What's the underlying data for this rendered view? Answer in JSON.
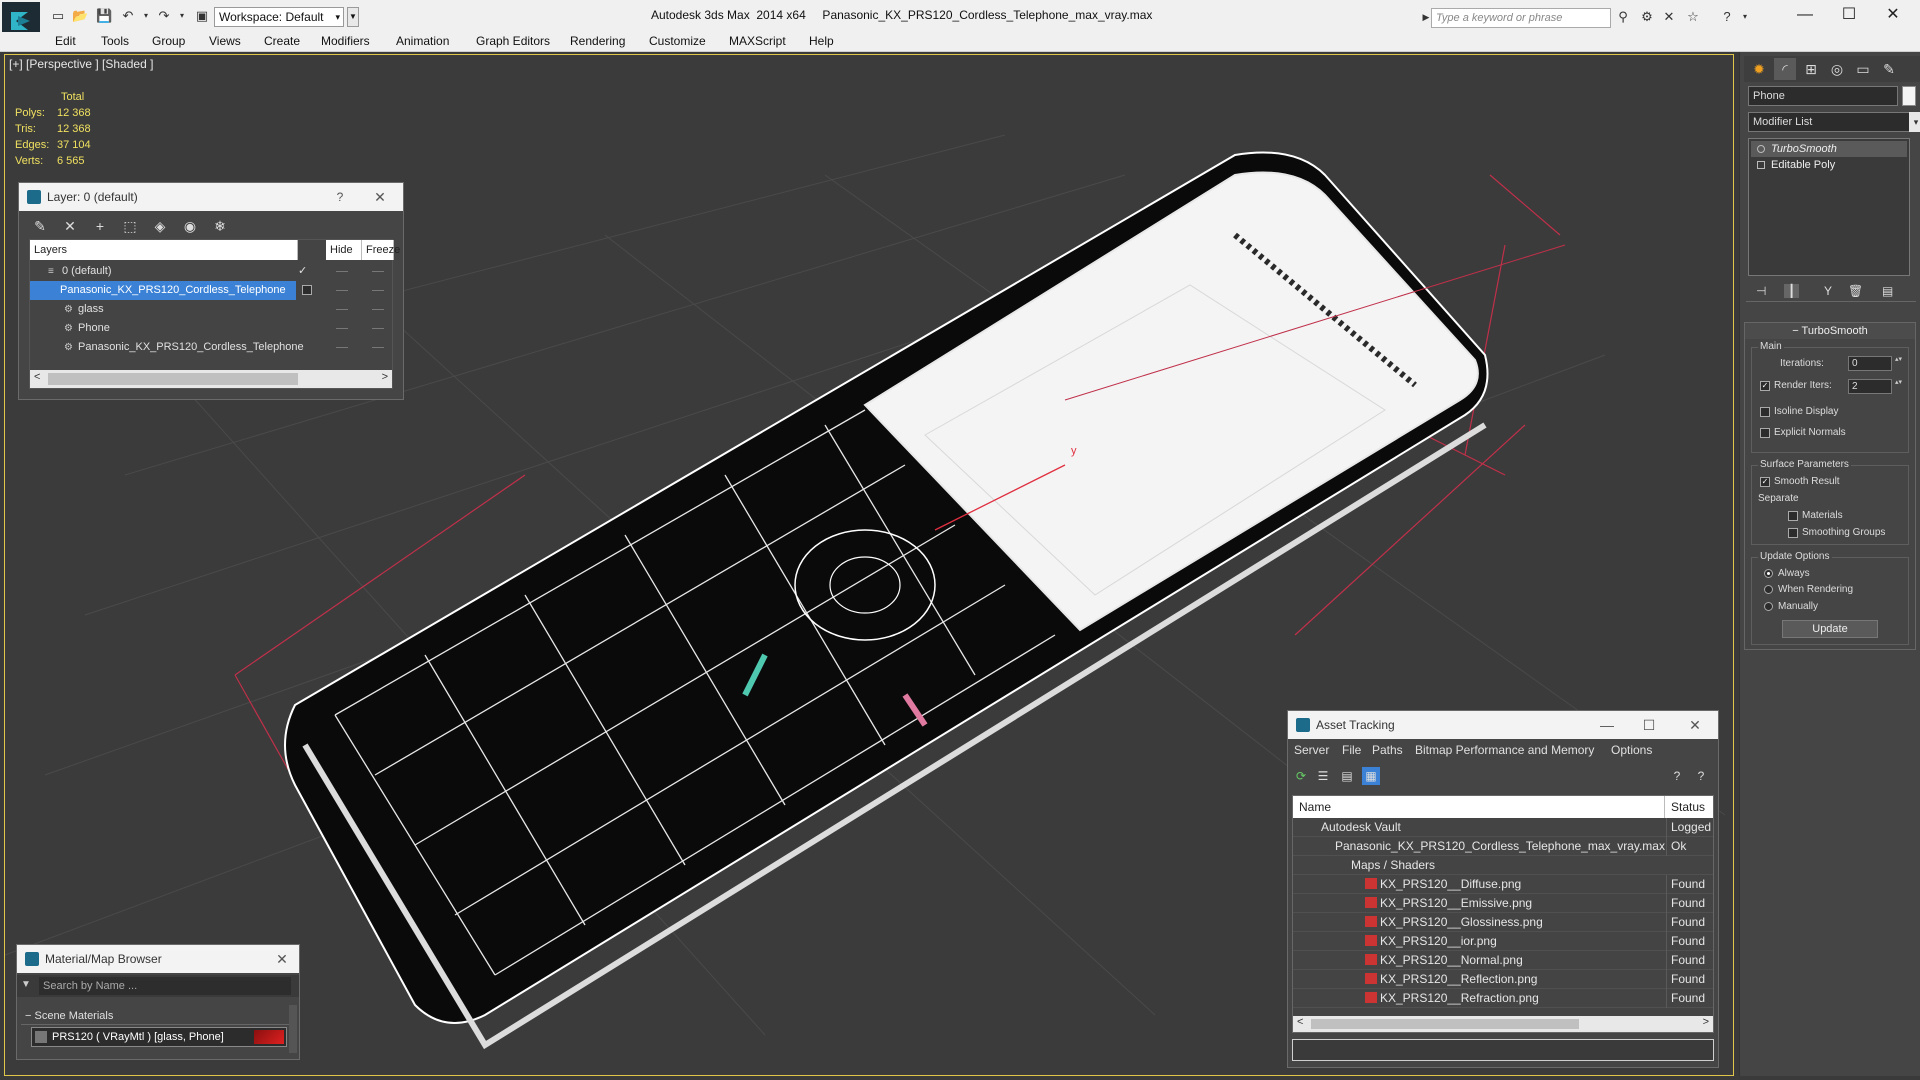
{
  "app": {
    "workspace": "Workspace: Default",
    "title": "Autodesk 3ds Max  2014 x64     Panasonic_KX_PRS120_Cordless_Telephone_max_vray.max",
    "search_placeholder": "Type a keyword or phrase"
  },
  "menu": [
    "Edit",
    "Tools",
    "Group",
    "Views",
    "Create",
    "Modifiers",
    "Animation",
    "Graph Editors",
    "Rendering",
    "Customize",
    "MAXScript",
    "Help"
  ],
  "viewport": {
    "label": "[+] [Perspective ] [Shaded ]",
    "stats": {
      "header": "Total",
      "rows": [
        {
          "label": "Polys:",
          "value": "12 368"
        },
        {
          "label": "Tris:",
          "value": "12 368"
        },
        {
          "label": "Edges:",
          "value": "37 104"
        },
        {
          "label": "Verts:",
          "value": "6 565"
        }
      ]
    },
    "axis_label": "y"
  },
  "layer_dialog": {
    "title": "Layer: 0 (default)",
    "help": "?",
    "columns": {
      "layers": "Layers",
      "hide": "Hide",
      "freeze": "Freeze"
    },
    "rows": [
      {
        "name": "0 (default)",
        "check": "✓"
      },
      {
        "name": "Panasonic_KX_PRS120_Cordless_Telephone"
      },
      {
        "name": "glass"
      },
      {
        "name": "Phone"
      },
      {
        "name": "Panasonic_KX_PRS120_Cordless_Telephone"
      }
    ]
  },
  "material_browser": {
    "title": "Material/Map Browser",
    "search_placeholder": "Search by Name ...",
    "section": "Scene Materials",
    "item": "PRS120  ( VRayMtl ) [glass, Phone]"
  },
  "asset_tracking": {
    "title": "Asset Tracking",
    "menu": [
      "Server",
      "File",
      "Paths",
      "Bitmap Performance and Memory",
      "Options"
    ],
    "columns": {
      "name": "Name",
      "status": "Status"
    },
    "rows": [
      {
        "name": "Autodesk Vault",
        "status": "Logged"
      },
      {
        "name": "Panasonic_KX_PRS120_Cordless_Telephone_max_vray.max",
        "status": "Ok"
      },
      {
        "name": "Maps / Shaders",
        "status": ""
      },
      {
        "name": "KX_PRS120__Diffuse.png",
        "status": "Found"
      },
      {
        "name": "KX_PRS120__Emissive.png",
        "status": "Found"
      },
      {
        "name": "KX_PRS120__Glossiness.png",
        "status": "Found"
      },
      {
        "name": "KX_PRS120__ior.png",
        "status": "Found"
      },
      {
        "name": "KX_PRS120__Normal.png",
        "status": "Found"
      },
      {
        "name": "KX_PRS120__Reflection.png",
        "status": "Found"
      },
      {
        "name": "KX_PRS120__Refraction.png",
        "status": "Found"
      }
    ]
  },
  "command_panel": {
    "object_name": "Phone",
    "modifier_list": "Modifier List",
    "stack": [
      "TurboSmooth",
      "Editable Poly"
    ],
    "turbosmooth": {
      "header": "TurboSmooth",
      "main_label": "Main",
      "iterations_label": "Iterations:",
      "iterations": "0",
      "render_iters_label": "Render Iters:",
      "render_iters": "2",
      "isoline": "Isoline Display",
      "explicit": "Explicit Normals",
      "surface_label": "Surface Parameters",
      "smooth_result": "Smooth Result",
      "separate": "Separate",
      "materials": "Materials",
      "smoothing_groups": "Smoothing Groups",
      "update_label": "Update Options",
      "always": "Always",
      "when_rendering": "When Rendering",
      "manually": "Manually",
      "update_button": "Update"
    }
  },
  "colors": {
    "viewport_bg": "#3b3b3b",
    "selection": "#3b82d6",
    "stats_text": "#f0e060",
    "wire": "#ffffff",
    "red_axis": "#e03040"
  }
}
